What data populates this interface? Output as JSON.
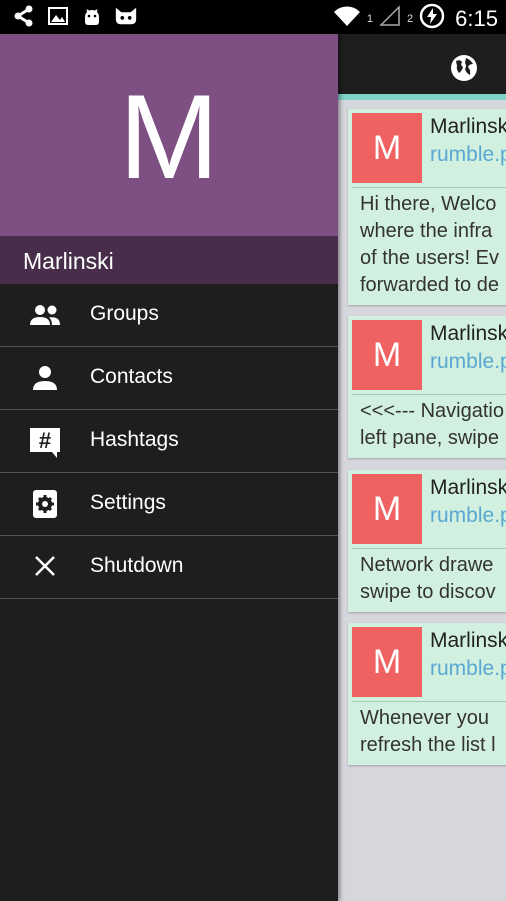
{
  "status_bar": {
    "time": "6:15",
    "signal_badge_1": "1",
    "signal_badge_2": "2",
    "left_icons": [
      "share-icon",
      "image-icon",
      "android-icon",
      "cat-icon"
    ]
  },
  "drawer": {
    "avatar_initial": "M",
    "username": "Marlinski",
    "header_color": "#7e4f82",
    "namebar_color": "#482e4b",
    "menu": [
      {
        "label": "Groups",
        "icon": "group-icon"
      },
      {
        "label": "Contacts",
        "icon": "person-icon"
      },
      {
        "label": "Hashtags",
        "icon": "hashtag-icon"
      },
      {
        "label": "Settings",
        "icon": "settings-icon"
      },
      {
        "label": "Shutdown",
        "icon": "close-icon"
      }
    ]
  },
  "content": {
    "appbar_icon": "globe-icon",
    "cards": [
      {
        "avatar": "M",
        "name": "Marlinski",
        "sub": "rumble.p",
        "text": [
          "Hi there, Welco",
          "where the infra",
          "of the users! Ev",
          "forwarded to de"
        ]
      },
      {
        "avatar": "M",
        "name": "Marlinski",
        "sub": "rumble.p",
        "text": [
          "<<<--- Navigatio",
          "left pane, swipe"
        ]
      },
      {
        "avatar": "M",
        "name": "Marlinski",
        "sub": "rumble.p",
        "text": [
          "Network drawe",
          "swipe to discov"
        ]
      },
      {
        "avatar": "M",
        "name": "Marlinski",
        "sub": "rumble.p",
        "text": [
          "Whenever you",
          "refresh the list l"
        ]
      }
    ]
  }
}
